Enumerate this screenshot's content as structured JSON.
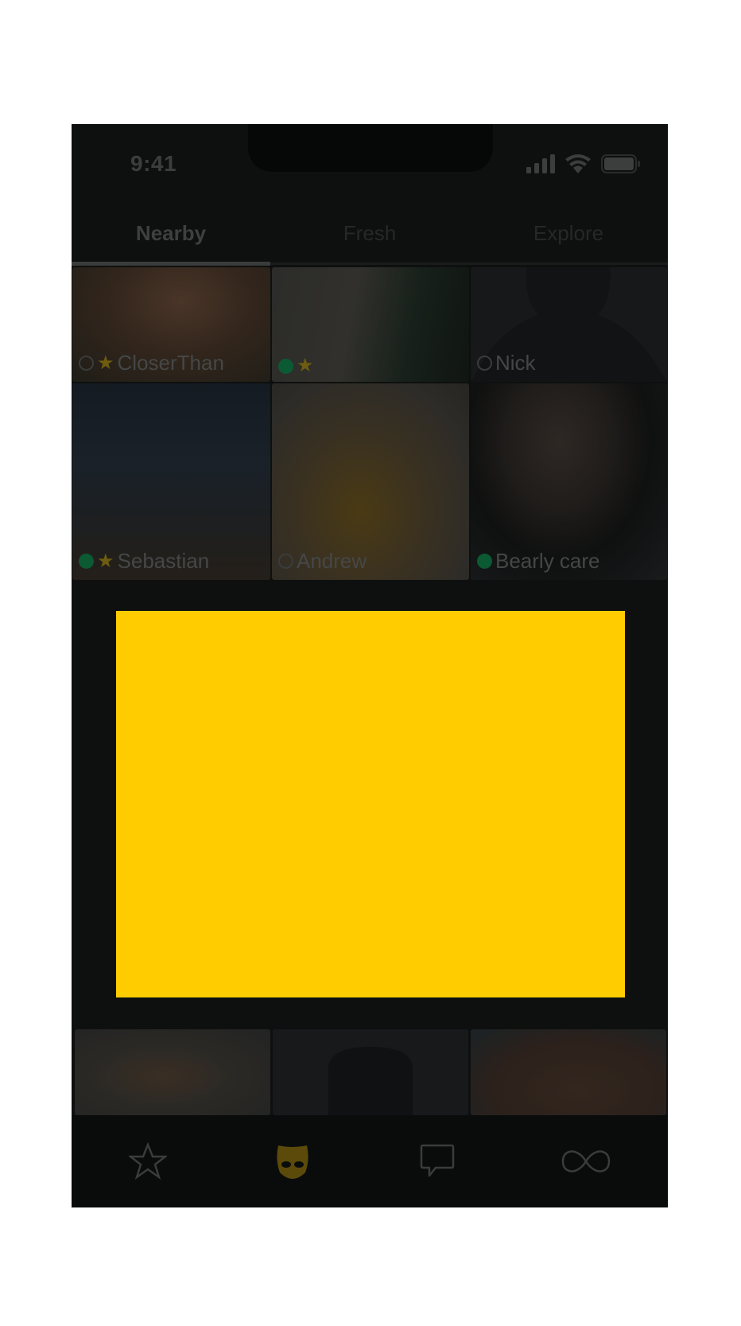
{
  "status_bar": {
    "time": "9:41",
    "icons": [
      "cellular-signal-icon",
      "wifi-icon",
      "battery-icon"
    ]
  },
  "tabs": [
    {
      "label": "Nearby",
      "active": true
    },
    {
      "label": "Fresh",
      "active": false
    },
    {
      "label": "Explore",
      "active": false
    }
  ],
  "grid": {
    "profiles": [
      {
        "name": "CloserThan",
        "online": false,
        "favorite": true
      },
      {
        "name": "",
        "online": true,
        "favorite": true
      },
      {
        "name": "Nick",
        "online": false,
        "favorite": false,
        "no_photo": true
      },
      {
        "name": "Sebastian",
        "online": true,
        "favorite": true
      },
      {
        "name": "Andrew",
        "online": false,
        "favorite": false
      },
      {
        "name": "Bearly care",
        "online": true,
        "favorite": false
      },
      {
        "name": "",
        "online": null,
        "favorite": false
      },
      {
        "name": "",
        "online": null,
        "favorite": false,
        "no_photo": true
      },
      {
        "name": "",
        "online": null,
        "favorite": false
      }
    ]
  },
  "ad": {
    "color": "#ffcc00"
  },
  "colors": {
    "online": "#0c5a33",
    "favorite_star": "#6e5c10",
    "active_nav": "#5c4a0a"
  },
  "nav": [
    {
      "name": "favorites",
      "icon": "star-outline-icon",
      "active": false
    },
    {
      "name": "browse",
      "icon": "grindr-mask-icon",
      "active": true
    },
    {
      "name": "inbox",
      "icon": "chat-bubble-icon",
      "active": false
    },
    {
      "name": "store",
      "icon": "infinity-icon",
      "active": false
    }
  ]
}
